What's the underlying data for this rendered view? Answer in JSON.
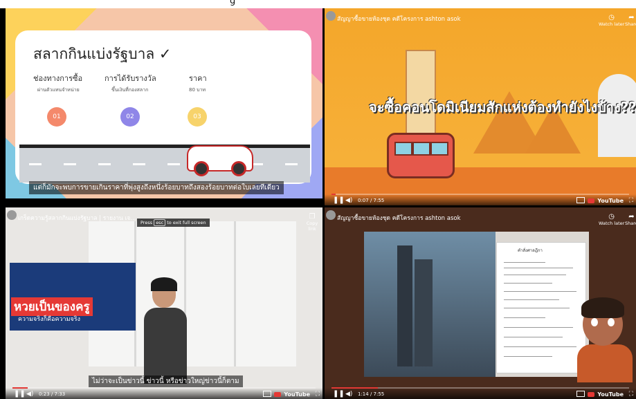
{
  "window": {
    "title": "g"
  },
  "slide1": {
    "title": "สลากกินแบ่งรัฐบาล ✓",
    "columns": [
      {
        "label": "ช่องทางการซื้อ",
        "sub": "ผ่านตัวแทนจำหน่าย"
      },
      {
        "label": "การได้รับรางวัล",
        "sub": "ขึ้นเงินที่กองสลาก"
      },
      {
        "label": "ราคา",
        "sub": "80 บาท"
      }
    ],
    "pins": [
      {
        "label": "01",
        "color": "#f4896b"
      },
      {
        "label": "02",
        "color": "#8f86e8"
      },
      {
        "label": "03",
        "color": "#f7d36b"
      }
    ],
    "caption": "แต่ก็มักจะพบการขายเกินราคาที่พุ่งสูงถึงหนึ่งร้อยบาทถึงสองร้อยบาทต่อใบเลยทีเดียว"
  },
  "video2": {
    "channel": "สัญญาซื้อขายห้องชุด คดีโครงการ ashton asok",
    "watch_later": "Watch later",
    "share": "Share",
    "headline": "จะซื้อคอนโดมิเนียมสักแห่งต้องทำยังไงบ้าง??",
    "time": "0:07 / 7:55",
    "progress": 0.015,
    "youtube": "YouTube"
  },
  "video3": {
    "channel": "เกร็ดความรู้สลากกินแบ่งรัฐบาล | รายงาน เจ...",
    "esc_hint_pre": "Press",
    "esc_key": "esc",
    "esc_hint_post": "to exit full screen",
    "copy_link": "Copy link",
    "news_headline": "หวยเป็นของครู",
    "news_sub": "ความจริงก็คือความจริง",
    "caption": "ไม่ว่าจะเป็นข่าวนี้ ข่าวนี้ หรือข่าวใหญ่ข่าวนี้ก็ตาม",
    "time": "0:23 / 7:33",
    "progress": 0.05,
    "youtube": "YouTube"
  },
  "video4": {
    "channel": "สัญญาซื้อขายห้องชุด คดีโครงการ ashton asok",
    "watch_later": "Watch later",
    "share": "Share",
    "doc_title": "คำสั่งศาลฎีกา",
    "time": "1:14 / 7:55",
    "progress": 0.156,
    "youtube": "YouTube"
  }
}
